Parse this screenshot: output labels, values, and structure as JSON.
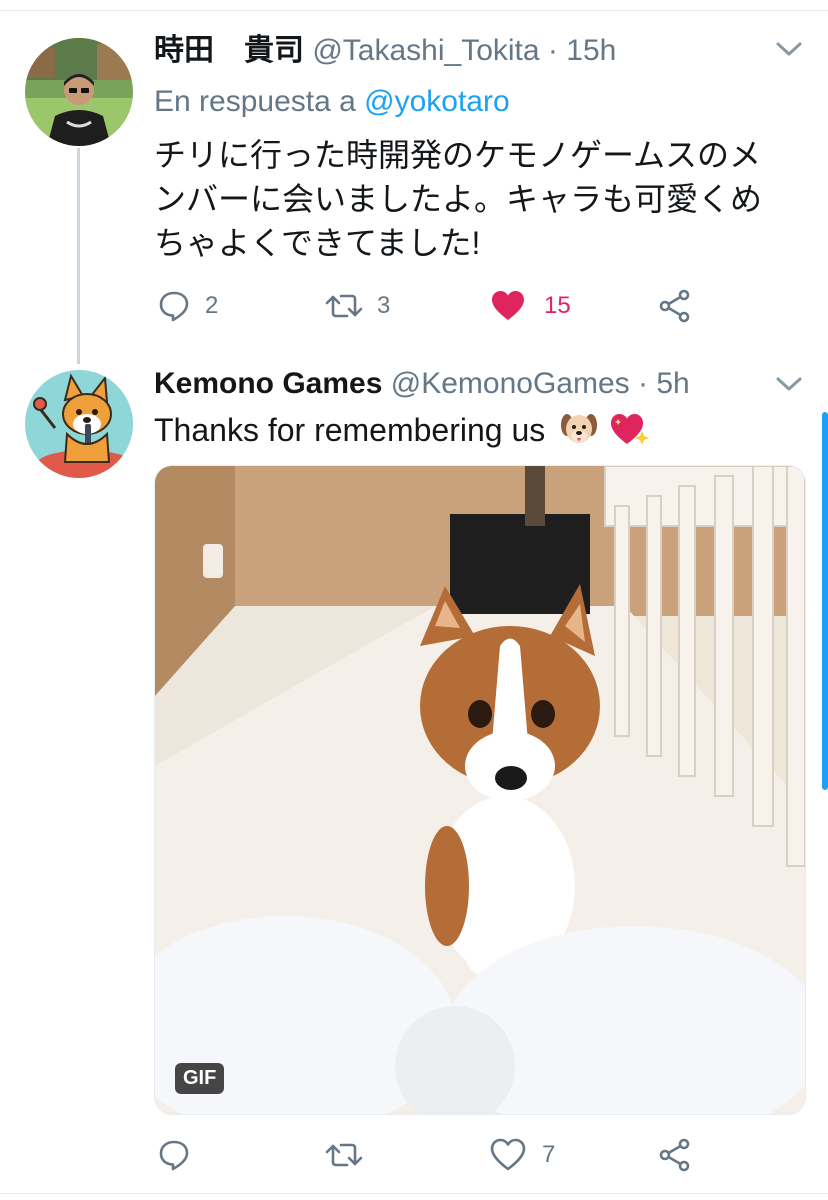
{
  "tweet1": {
    "display_name": "時田　貴司",
    "handle": "@Takashi_Tokita",
    "separator": "·",
    "time": "15h",
    "reply_prefix": "En respuesta a",
    "reply_mention": "@yokotaro",
    "text_lines": [
      "チリに行った時開発のケモノゲームスのメ",
      "ンバーに会いましたよ。キャラも可愛くめ",
      "ちゃよくできてました!"
    ],
    "replies": "2",
    "retweets": "3",
    "likes": "15",
    "liked": true
  },
  "tweet2": {
    "display_name": "Kemono Games",
    "handle": "@KemonoGames",
    "separator": "·",
    "time": "5h",
    "text": "Thanks for remembering us",
    "emojis": [
      "dog-face-emoji",
      "sparkling-heart-emoji"
    ],
    "media_badge": "GIF",
    "replies": "",
    "retweets": "",
    "likes": "7",
    "liked": false
  },
  "colors": {
    "accent": "#1da1f2",
    "like": "#e0245e",
    "secondary_text": "#657786",
    "thread_line": "#ccd6dd"
  },
  "icons": [
    "reply-icon",
    "retweet-icon",
    "heart-icon",
    "share-icon",
    "chevron-down-icon"
  ]
}
